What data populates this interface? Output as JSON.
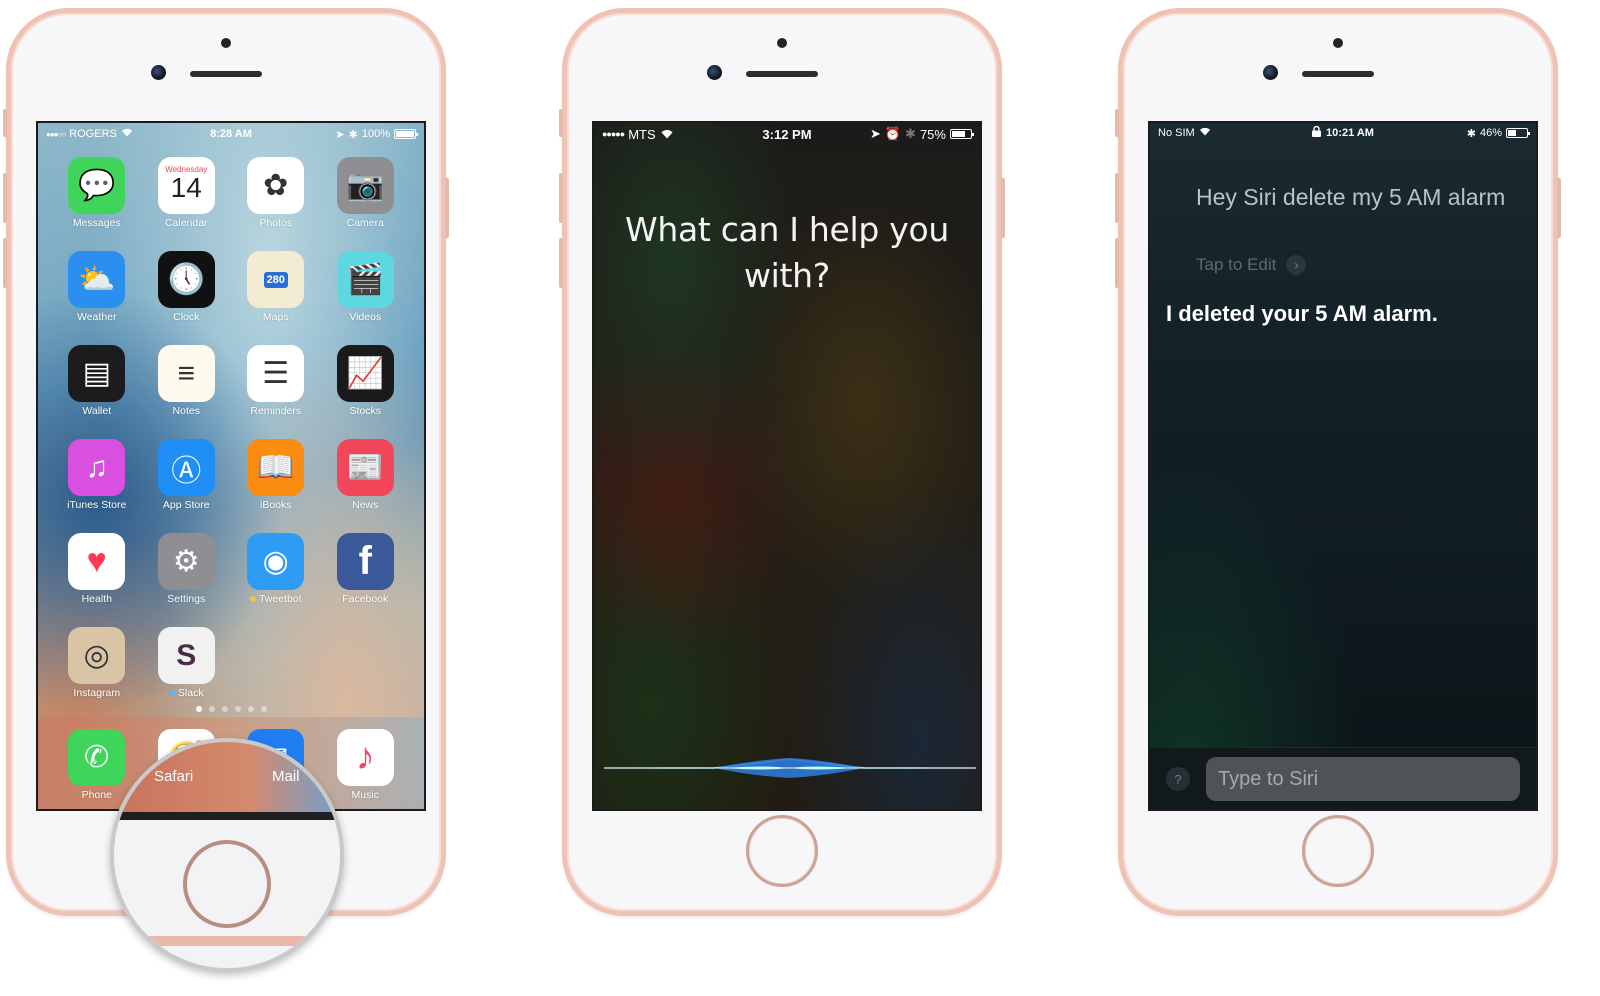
{
  "phones": {
    "home": {
      "status": {
        "carrier": "ROGERS",
        "signal": "●●●○○",
        "time": "8:28 AM",
        "battery": "100%",
        "battery_fraction": 1.0
      },
      "apps": [
        {
          "label": "Messages",
          "icon": "messages-icon",
          "glyph": "💬",
          "bg": "#3fd45a"
        },
        {
          "label": "Calendar",
          "icon": "calendar-icon",
          "glyph": "14",
          "bg": "#ffffff",
          "sub": "Wednesday"
        },
        {
          "label": "Photos",
          "icon": "photos-icon",
          "glyph": "✿",
          "bg": "#ffffff"
        },
        {
          "label": "Camera",
          "icon": "camera-icon",
          "glyph": "📷",
          "bg": "#8e8e93"
        },
        {
          "label": "Weather",
          "icon": "weather-icon",
          "glyph": "⛅",
          "bg": "#2b8ff0"
        },
        {
          "label": "Clock",
          "icon": "clock-icon",
          "glyph": "🕔",
          "bg": "#111111"
        },
        {
          "label": "Maps",
          "icon": "maps-icon",
          "glyph": "280",
          "bg": "#f4ecd2"
        },
        {
          "label": "Videos",
          "icon": "videos-icon",
          "glyph": "🎬",
          "bg": "#5fd7e0"
        },
        {
          "label": "Wallet",
          "icon": "wallet-icon",
          "glyph": "▤",
          "bg": "#1c1c1e"
        },
        {
          "label": "Notes",
          "icon": "notes-icon",
          "glyph": "≡",
          "bg": "#fdf9ec"
        },
        {
          "label": "Reminders",
          "icon": "reminders-icon",
          "glyph": "☰",
          "bg": "#ffffff"
        },
        {
          "label": "Stocks",
          "icon": "stocks-icon",
          "glyph": "📈",
          "bg": "#1a1a1a"
        },
        {
          "label": "iTunes Store",
          "icon": "itunes-store-icon",
          "glyph": "♫",
          "bg": "#d94fe0"
        },
        {
          "label": "App Store",
          "icon": "app-store-icon",
          "glyph": "Ⓐ",
          "bg": "#1f8ff5"
        },
        {
          "label": "iBooks",
          "icon": "ibooks-icon",
          "glyph": "📖",
          "bg": "#fb8c12"
        },
        {
          "label": "News",
          "icon": "news-icon",
          "glyph": "📰",
          "bg": "#f2465a"
        },
        {
          "label": "Health",
          "icon": "health-icon",
          "glyph": "♥",
          "bg": "#ffffff"
        },
        {
          "label": "Settings",
          "icon": "settings-icon",
          "glyph": "⚙",
          "bg": "#8e8e93"
        },
        {
          "label": "Tweetbot",
          "icon": "tweetbot-icon",
          "glyph": "◉",
          "bg": "#2e9cf5",
          "dot": "#f5c04a"
        },
        {
          "label": "Facebook",
          "icon": "facebook-icon",
          "glyph": "f",
          "bg": "#3b5998"
        },
        {
          "label": "Instagram",
          "icon": "instagram-icon",
          "glyph": "◎",
          "bg": "#d9c5a5"
        },
        {
          "label": "Slack",
          "icon": "slack-icon",
          "glyph": "S",
          "bg": "#f1f1f1",
          "dot": "#5ab6ec"
        }
      ],
      "page_count": 6,
      "active_page": 1,
      "dock": [
        {
          "label": "Phone",
          "icon": "phone-icon",
          "glyph": "✆",
          "bg": "#3fd45a"
        },
        {
          "label": "Safari",
          "icon": "safari-icon",
          "glyph": "🧭",
          "bg": "#ffffff"
        },
        {
          "label": "Mail",
          "icon": "mail-icon",
          "glyph": "✉",
          "bg": "#1f7ff2"
        },
        {
          "label": "Music",
          "icon": "music-icon",
          "glyph": "♪",
          "bg": "#ffffff"
        }
      ],
      "magnifier_labels": {
        "left": "Safari",
        "right": "Mail"
      }
    },
    "siri_listening": {
      "status": {
        "carrier": "MTS",
        "signal": "●●●●●",
        "time": "3:12 PM",
        "battery": "75%",
        "battery_fraction": 0.75
      },
      "prompt": "What can I help you with?"
    },
    "siri_response": {
      "status": {
        "carrier": "No SIM",
        "time": "10:21 AM",
        "battery": "46%",
        "battery_fraction": 0.46
      },
      "user_query": "Hey Siri delete my 5 AM alarm",
      "tap_to_edit": "Tap to Edit",
      "answer": "I deleted your 5 AM alarm.",
      "help_label": "?",
      "input_placeholder": "Type to Siri"
    }
  }
}
